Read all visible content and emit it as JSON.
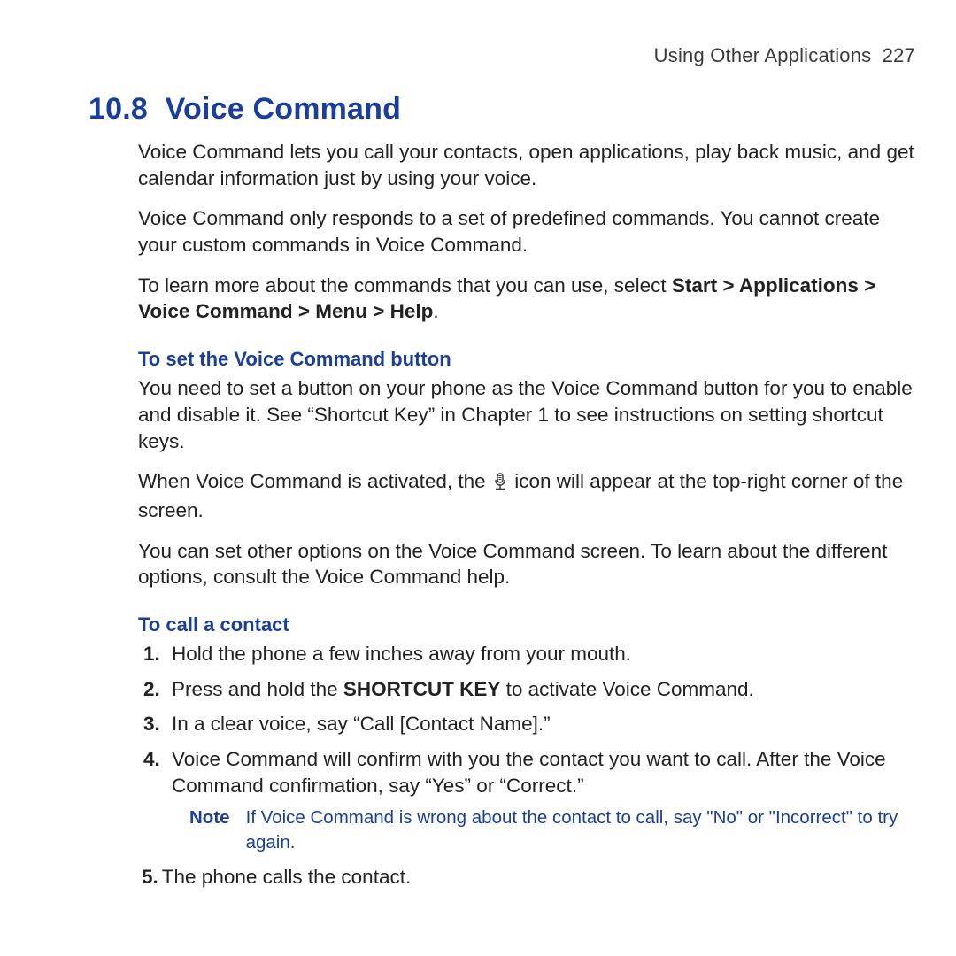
{
  "header": {
    "chapter_title": "Using Other Applications",
    "page_number": "227"
  },
  "section": {
    "number": "10.8",
    "title": "Voice Command"
  },
  "intro": {
    "p1": "Voice Command lets you call your contacts, open applications, play back music, and get calendar information just by using your voice.",
    "p2": "Voice Command only responds to a set of predefined commands. You cannot create your custom commands in Voice Command.",
    "p3_a": "To learn more about the commands that you can use, select ",
    "p3_bold": "Start > Applications > Voice Command > Menu > Help",
    "p3_b": "."
  },
  "set_button": {
    "heading": "To set the Voice Command button",
    "p1": "You need to set a button on your phone as the Voice Command button for you to enable and disable it. See “Shortcut Key” in Chapter 1 to see instructions on setting shortcut keys.",
    "p2_a": "When Voice Command is activated, the ",
    "p2_b": " icon will appear at the top-right corner of the screen.",
    "p3": "You can set other options on the Voice Command screen. To learn about the different options, consult the Voice Command help."
  },
  "call_contact": {
    "heading": "To call a contact",
    "steps": {
      "s1": "Hold the phone a few inches away from your mouth.",
      "s2_a": "Press and hold the ",
      "s2_bold": "SHORTCUT KEY",
      "s2_b": " to activate Voice Command.",
      "s3": "In a clear voice, say “Call [Contact Name].”",
      "s4": "Voice Command will confirm with you the contact you want to call. After the Voice Command confirmation, say “Yes” or “Correct.”",
      "s5": "The phone calls the contact."
    },
    "note": {
      "label": "Note",
      "text": "If Voice Command is wrong about the contact to call, say \"No\" or \"Incorrect\" to try again."
    }
  },
  "icon_name": "voice-command-icon"
}
